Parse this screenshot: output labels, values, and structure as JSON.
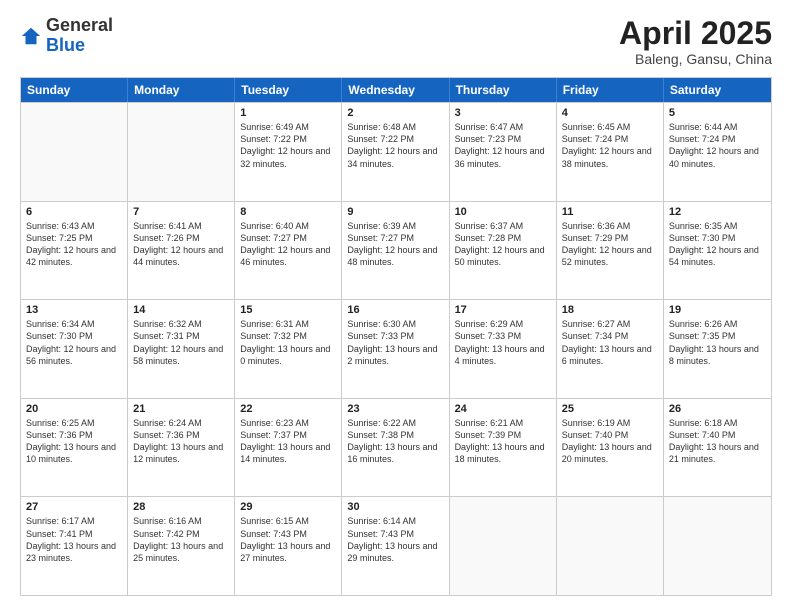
{
  "header": {
    "logo_general": "General",
    "logo_blue": "Blue",
    "title": "April 2025",
    "location": "Baleng, Gansu, China"
  },
  "days": [
    "Sunday",
    "Monday",
    "Tuesday",
    "Wednesday",
    "Thursday",
    "Friday",
    "Saturday"
  ],
  "weeks": [
    [
      {
        "num": "",
        "sunrise": "",
        "sunset": "",
        "daylight": ""
      },
      {
        "num": "",
        "sunrise": "",
        "sunset": "",
        "daylight": ""
      },
      {
        "num": "1",
        "sunrise": "Sunrise: 6:49 AM",
        "sunset": "Sunset: 7:22 PM",
        "daylight": "Daylight: 12 hours and 32 minutes."
      },
      {
        "num": "2",
        "sunrise": "Sunrise: 6:48 AM",
        "sunset": "Sunset: 7:22 PM",
        "daylight": "Daylight: 12 hours and 34 minutes."
      },
      {
        "num": "3",
        "sunrise": "Sunrise: 6:47 AM",
        "sunset": "Sunset: 7:23 PM",
        "daylight": "Daylight: 12 hours and 36 minutes."
      },
      {
        "num": "4",
        "sunrise": "Sunrise: 6:45 AM",
        "sunset": "Sunset: 7:24 PM",
        "daylight": "Daylight: 12 hours and 38 minutes."
      },
      {
        "num": "5",
        "sunrise": "Sunrise: 6:44 AM",
        "sunset": "Sunset: 7:24 PM",
        "daylight": "Daylight: 12 hours and 40 minutes."
      }
    ],
    [
      {
        "num": "6",
        "sunrise": "Sunrise: 6:43 AM",
        "sunset": "Sunset: 7:25 PM",
        "daylight": "Daylight: 12 hours and 42 minutes."
      },
      {
        "num": "7",
        "sunrise": "Sunrise: 6:41 AM",
        "sunset": "Sunset: 7:26 PM",
        "daylight": "Daylight: 12 hours and 44 minutes."
      },
      {
        "num": "8",
        "sunrise": "Sunrise: 6:40 AM",
        "sunset": "Sunset: 7:27 PM",
        "daylight": "Daylight: 12 hours and 46 minutes."
      },
      {
        "num": "9",
        "sunrise": "Sunrise: 6:39 AM",
        "sunset": "Sunset: 7:27 PM",
        "daylight": "Daylight: 12 hours and 48 minutes."
      },
      {
        "num": "10",
        "sunrise": "Sunrise: 6:37 AM",
        "sunset": "Sunset: 7:28 PM",
        "daylight": "Daylight: 12 hours and 50 minutes."
      },
      {
        "num": "11",
        "sunrise": "Sunrise: 6:36 AM",
        "sunset": "Sunset: 7:29 PM",
        "daylight": "Daylight: 12 hours and 52 minutes."
      },
      {
        "num": "12",
        "sunrise": "Sunrise: 6:35 AM",
        "sunset": "Sunset: 7:30 PM",
        "daylight": "Daylight: 12 hours and 54 minutes."
      }
    ],
    [
      {
        "num": "13",
        "sunrise": "Sunrise: 6:34 AM",
        "sunset": "Sunset: 7:30 PM",
        "daylight": "Daylight: 12 hours and 56 minutes."
      },
      {
        "num": "14",
        "sunrise": "Sunrise: 6:32 AM",
        "sunset": "Sunset: 7:31 PM",
        "daylight": "Daylight: 12 hours and 58 minutes."
      },
      {
        "num": "15",
        "sunrise": "Sunrise: 6:31 AM",
        "sunset": "Sunset: 7:32 PM",
        "daylight": "Daylight: 13 hours and 0 minutes."
      },
      {
        "num": "16",
        "sunrise": "Sunrise: 6:30 AM",
        "sunset": "Sunset: 7:33 PM",
        "daylight": "Daylight: 13 hours and 2 minutes."
      },
      {
        "num": "17",
        "sunrise": "Sunrise: 6:29 AM",
        "sunset": "Sunset: 7:33 PM",
        "daylight": "Daylight: 13 hours and 4 minutes."
      },
      {
        "num": "18",
        "sunrise": "Sunrise: 6:27 AM",
        "sunset": "Sunset: 7:34 PM",
        "daylight": "Daylight: 13 hours and 6 minutes."
      },
      {
        "num": "19",
        "sunrise": "Sunrise: 6:26 AM",
        "sunset": "Sunset: 7:35 PM",
        "daylight": "Daylight: 13 hours and 8 minutes."
      }
    ],
    [
      {
        "num": "20",
        "sunrise": "Sunrise: 6:25 AM",
        "sunset": "Sunset: 7:36 PM",
        "daylight": "Daylight: 13 hours and 10 minutes."
      },
      {
        "num": "21",
        "sunrise": "Sunrise: 6:24 AM",
        "sunset": "Sunset: 7:36 PM",
        "daylight": "Daylight: 13 hours and 12 minutes."
      },
      {
        "num": "22",
        "sunrise": "Sunrise: 6:23 AM",
        "sunset": "Sunset: 7:37 PM",
        "daylight": "Daylight: 13 hours and 14 minutes."
      },
      {
        "num": "23",
        "sunrise": "Sunrise: 6:22 AM",
        "sunset": "Sunset: 7:38 PM",
        "daylight": "Daylight: 13 hours and 16 minutes."
      },
      {
        "num": "24",
        "sunrise": "Sunrise: 6:21 AM",
        "sunset": "Sunset: 7:39 PM",
        "daylight": "Daylight: 13 hours and 18 minutes."
      },
      {
        "num": "25",
        "sunrise": "Sunrise: 6:19 AM",
        "sunset": "Sunset: 7:40 PM",
        "daylight": "Daylight: 13 hours and 20 minutes."
      },
      {
        "num": "26",
        "sunrise": "Sunrise: 6:18 AM",
        "sunset": "Sunset: 7:40 PM",
        "daylight": "Daylight: 13 hours and 21 minutes."
      }
    ],
    [
      {
        "num": "27",
        "sunrise": "Sunrise: 6:17 AM",
        "sunset": "Sunset: 7:41 PM",
        "daylight": "Daylight: 13 hours and 23 minutes."
      },
      {
        "num": "28",
        "sunrise": "Sunrise: 6:16 AM",
        "sunset": "Sunset: 7:42 PM",
        "daylight": "Daylight: 13 hours and 25 minutes."
      },
      {
        "num": "29",
        "sunrise": "Sunrise: 6:15 AM",
        "sunset": "Sunset: 7:43 PM",
        "daylight": "Daylight: 13 hours and 27 minutes."
      },
      {
        "num": "30",
        "sunrise": "Sunrise: 6:14 AM",
        "sunset": "Sunset: 7:43 PM",
        "daylight": "Daylight: 13 hours and 29 minutes."
      },
      {
        "num": "",
        "sunrise": "",
        "sunset": "",
        "daylight": ""
      },
      {
        "num": "",
        "sunrise": "",
        "sunset": "",
        "daylight": ""
      },
      {
        "num": "",
        "sunrise": "",
        "sunset": "",
        "daylight": ""
      }
    ]
  ]
}
